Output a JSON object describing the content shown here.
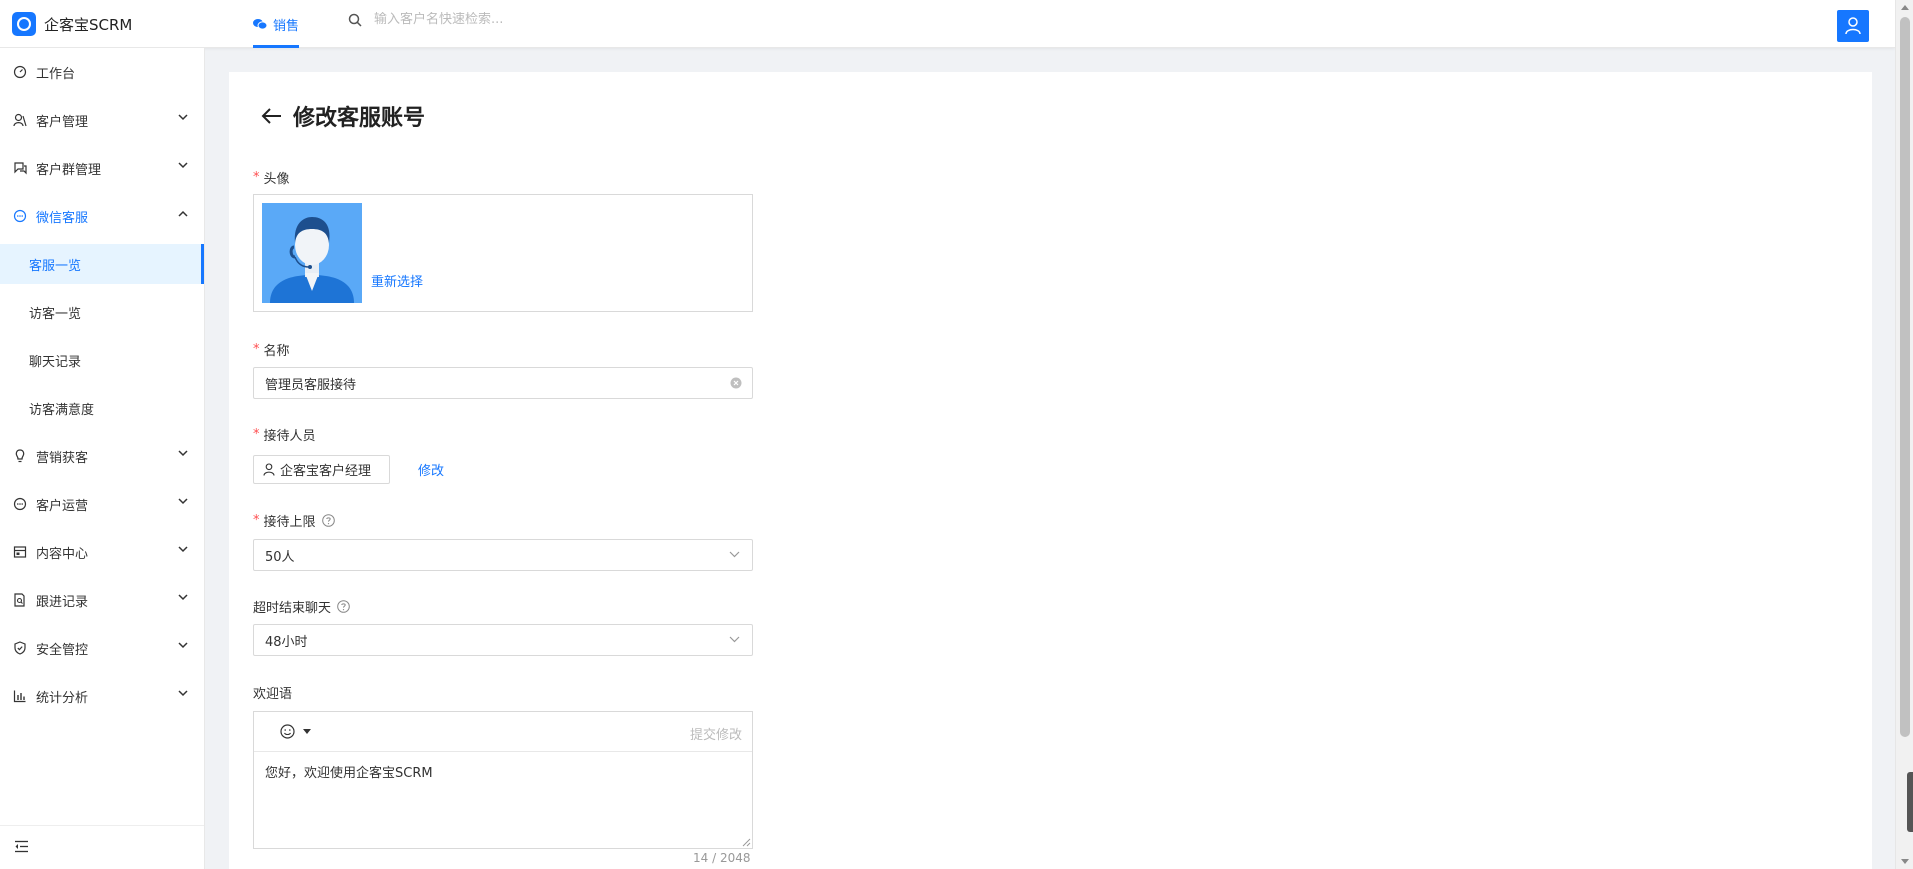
{
  "app": {
    "brand_name": "企客宝SCRM"
  },
  "header": {
    "tab_sales": "销售",
    "search_placeholder": "输入客户名快速检索..."
  },
  "sidebar": {
    "items": [
      {
        "label": "工作台"
      },
      {
        "label": "客户管理"
      },
      {
        "label": "客户群管理"
      },
      {
        "label": "微信客服"
      },
      {
        "label": "客服一览"
      },
      {
        "label": "访客一览"
      },
      {
        "label": "聊天记录"
      },
      {
        "label": "访客满意度"
      },
      {
        "label": "营销获客"
      },
      {
        "label": "客户运营"
      },
      {
        "label": "内容中心"
      },
      {
        "label": "跟进记录"
      },
      {
        "label": "安全管控"
      },
      {
        "label": "统计分析"
      }
    ]
  },
  "page": {
    "title": "修改客服账号",
    "required_mark": "*",
    "avatar": {
      "label": "头像",
      "reselect": "重新选择"
    },
    "name": {
      "label": "名称",
      "value": "管理员客服接待"
    },
    "receptionist": {
      "label": "接待人员",
      "value": "企客宝客户经理",
      "modify": "修改"
    },
    "limit": {
      "label": "接待上限",
      "value": "50人"
    },
    "timeout": {
      "label": "超时结束聊天",
      "value": "48小时"
    },
    "welcome": {
      "label": "欢迎语",
      "submit_edit": "提交修改",
      "text": "您好，欢迎使用企客宝SCRM",
      "counter": "14 / 2048"
    }
  },
  "colors": {
    "accent": "#1677ff",
    "required": "#ff4d4f"
  }
}
